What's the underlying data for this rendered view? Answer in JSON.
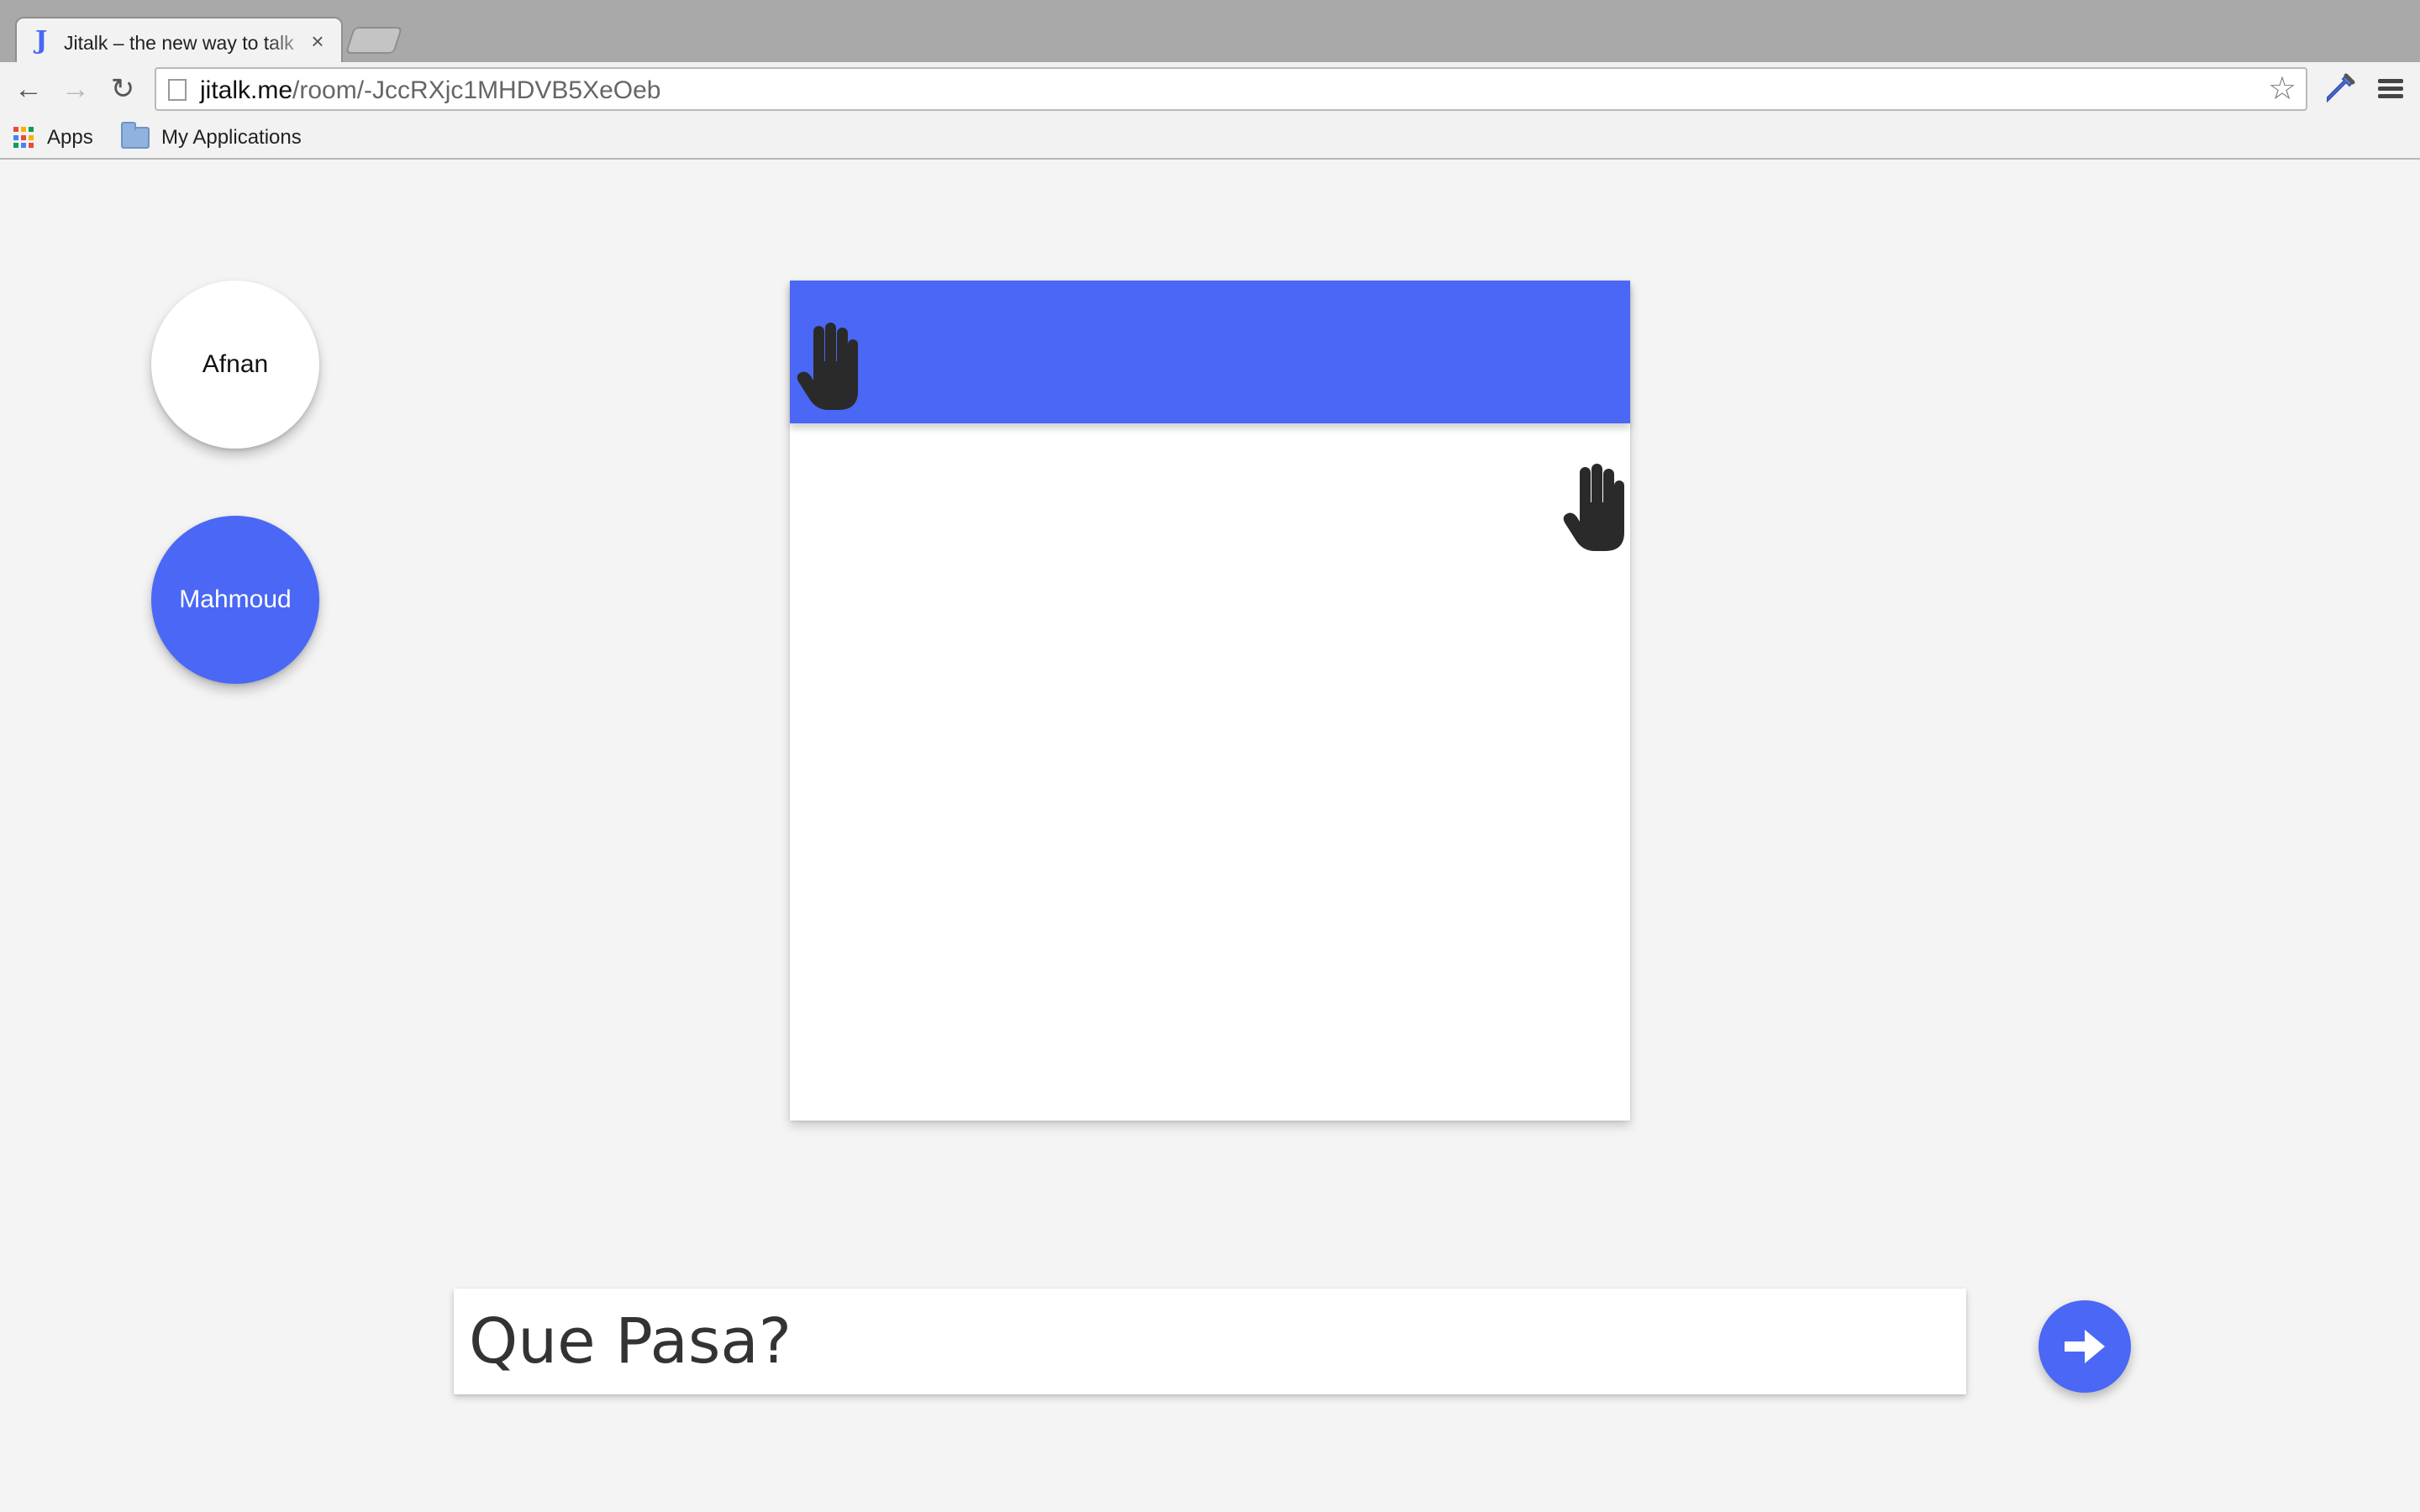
{
  "browser": {
    "tab": {
      "favicon": "J",
      "title": "Jitalk – the new way to talk",
      "close": "×"
    },
    "nav": {
      "back_icon": "arrow-left",
      "forward_icon": "arrow-right",
      "reload_icon": "reload"
    },
    "address": {
      "host": "jitalk.me",
      "path": "/room/-JccRXjc1MHDVB5XeOeb"
    },
    "bookmarks": [
      {
        "label": "Apps",
        "icon": "apps-grid-icon"
      },
      {
        "label": "My Applications",
        "icon": "folder-icon"
      }
    ]
  },
  "users": [
    {
      "name": "Afnan",
      "active": false
    },
    {
      "name": "Mahmoud",
      "active": true
    }
  ],
  "room": {
    "header_icon": "raised-hand-icon",
    "message_icons": [
      "raised-hand-icon"
    ]
  },
  "composer": {
    "placeholder": "Que Pasa?",
    "value": "",
    "send_icon": "arrow-right-icon"
  },
  "colors": {
    "accent": "#4a67f5",
    "background": "#f4f4f4",
    "surface": "#ffffff",
    "hand": "#2a2a2a"
  }
}
